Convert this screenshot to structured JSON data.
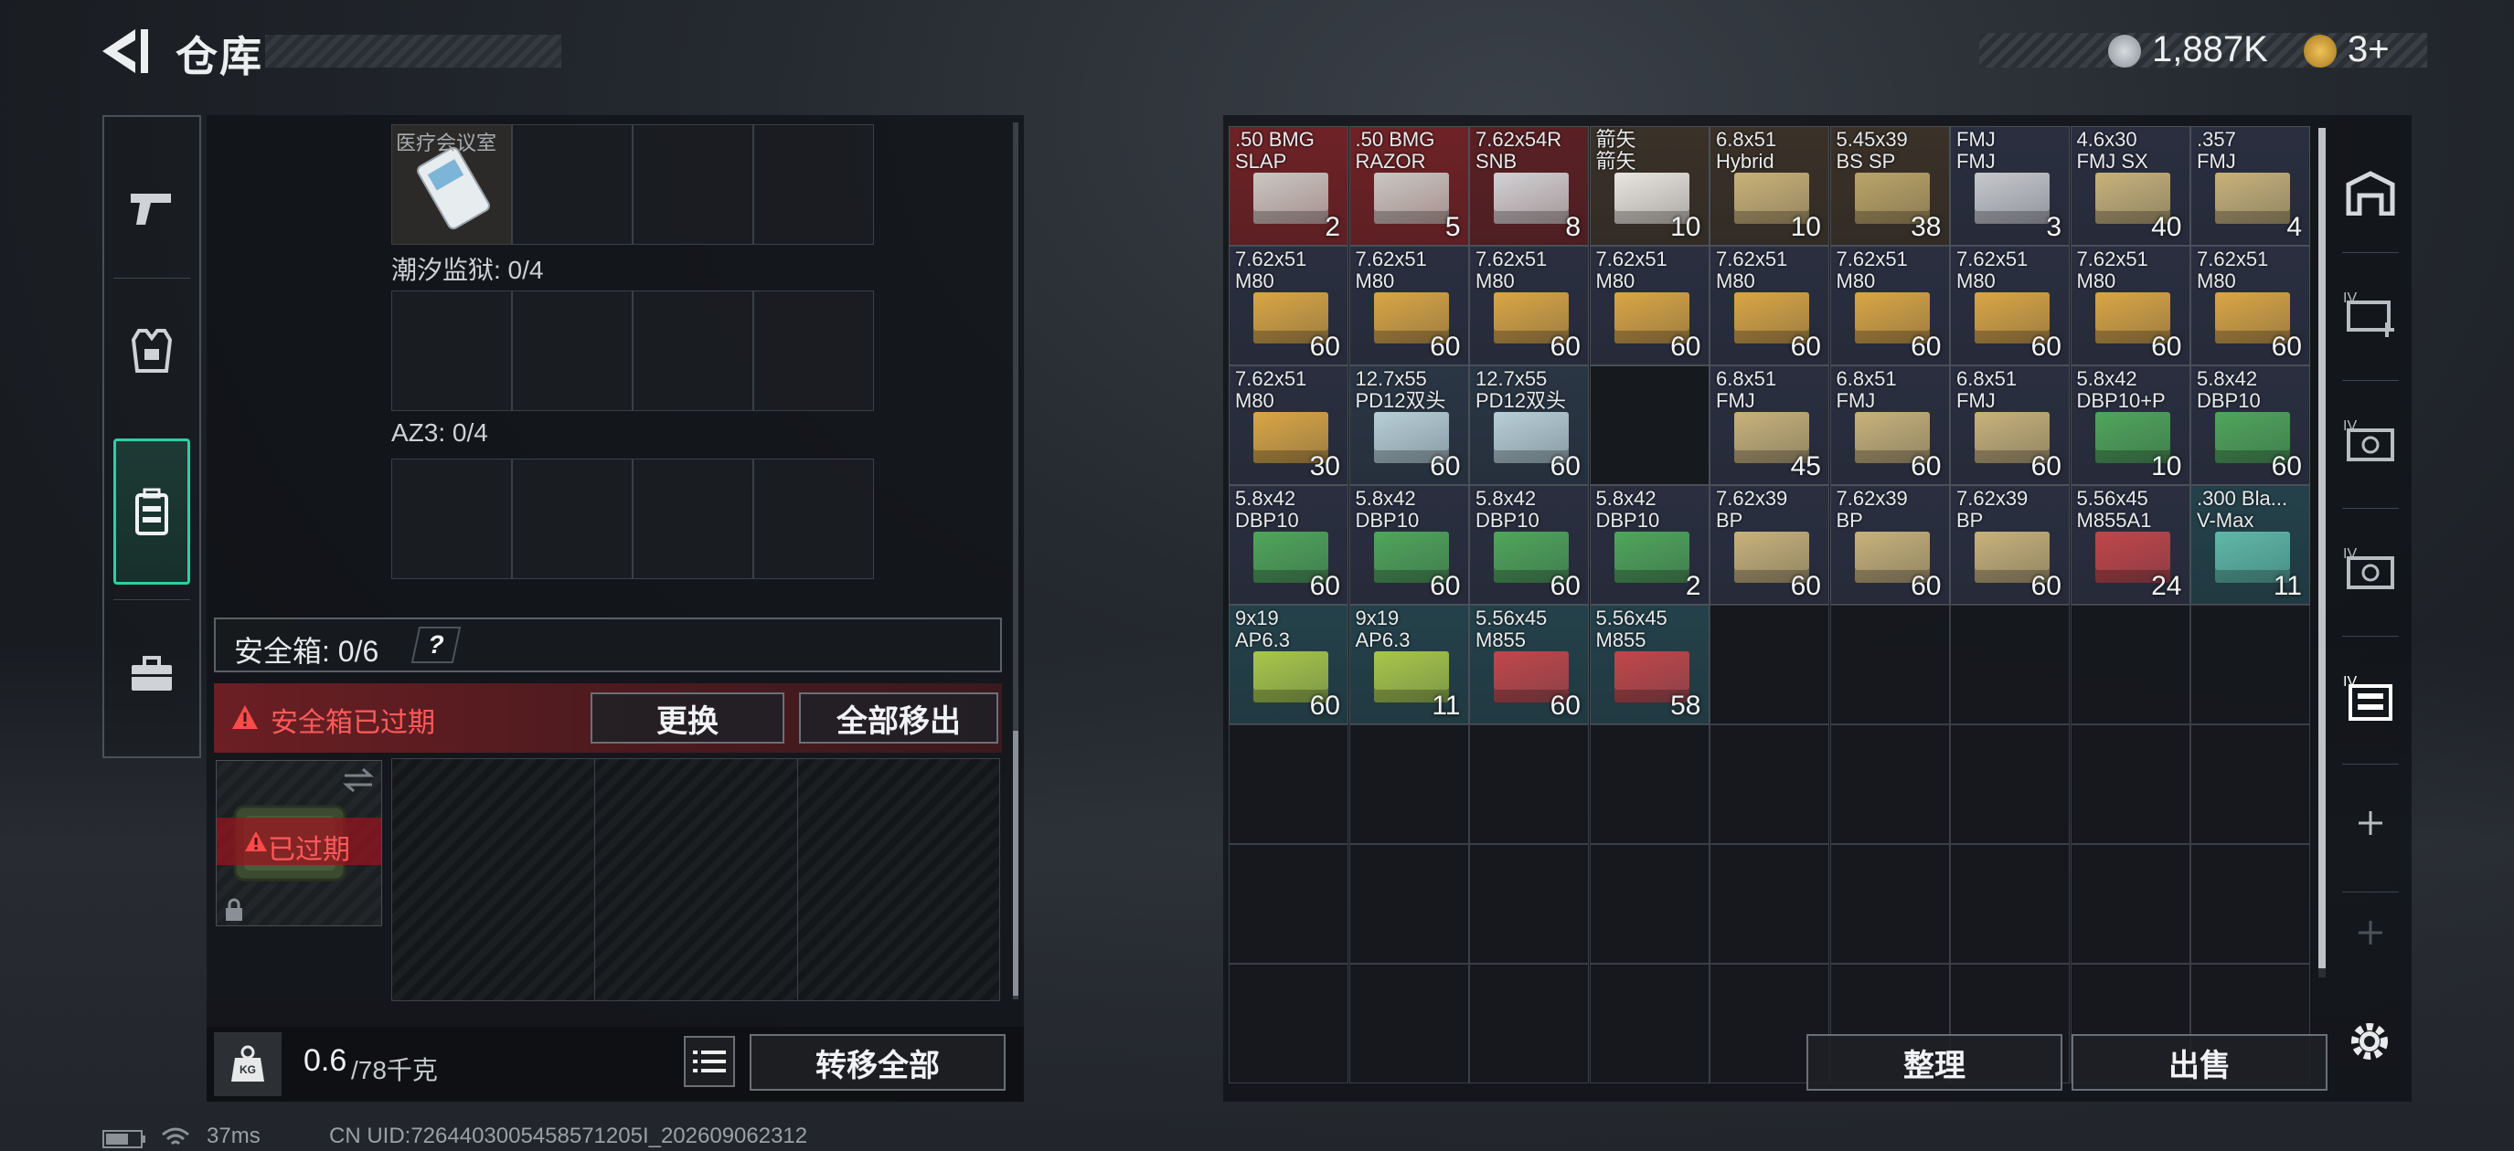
{
  "header": {
    "title": "仓库",
    "currency1": "1,887K",
    "currency2": "3+"
  },
  "left": {
    "slot_label_top": "医疗会议室",
    "section1": "潮汐监狱: 0/4",
    "section2": "AZ3: 0/4",
    "safebox_label": "安全箱: 0/6",
    "help": "?",
    "expired_msg": "安全箱已过期",
    "replace_btn": "更换",
    "move_all_out_btn": "全部移出",
    "expired_badge": "已过期",
    "weight_value": "0.6",
    "weight_total": "/78千克",
    "weight_icon_text": "KG",
    "transfer_all_btn": "转移全部"
  },
  "right": {
    "sort_btn": "整理",
    "sell_btn": "出售",
    "items": [
      {
        "name": ".50 BMG\nSLAP",
        "count": "2",
        "bg": "#6e2226",
        "box": "#c9c7c2"
      },
      {
        "name": ".50 BMG\nRAZOR",
        "count": "5",
        "bg": "#6e2226",
        "box": "#c9c7c2"
      },
      {
        "name": "7.62x54R\nSNB",
        "count": "8",
        "bg": "#5a2024",
        "box": "#d0d2d4"
      },
      {
        "name": "箭矢\n箭矢",
        "count": "10",
        "bg": "#3a3128",
        "box": "#e8e6e2"
      },
      {
        "name": "6.8x51\nHybrid",
        "count": "10",
        "bg": "#3a3128",
        "box": "#c8b27a"
      },
      {
        "name": "5.45x39\nBS SP",
        "count": "38",
        "bg": "#3a3128",
        "box": "#b9a46a"
      },
      {
        "name": "FMJ\nFMJ",
        "count": "3",
        "bg": "#2a2f40",
        "box": "#c6c8cc"
      },
      {
        "name": "4.6x30\nFMJ SX",
        "count": "40",
        "bg": "#2a2f40",
        "box": "#c8b27a"
      },
      {
        "name": ".357\nFMJ",
        "count": "4",
        "bg": "#2a2f40",
        "box": "#c8b27a"
      },
      {
        "name": "7.62x51\nM80",
        "count": "60",
        "bg": "#2a2f40",
        "box": "#d9a645"
      },
      {
        "name": "7.62x51\nM80",
        "count": "60",
        "bg": "#2a2f40",
        "box": "#d9a645"
      },
      {
        "name": "7.62x51\nM80",
        "count": "60",
        "bg": "#2a2f40",
        "box": "#d9a645"
      },
      {
        "name": "7.62x51\nM80",
        "count": "60",
        "bg": "#2a2f40",
        "box": "#d9a645"
      },
      {
        "name": "7.62x51\nM80",
        "count": "60",
        "bg": "#2a2f40",
        "box": "#d9a645"
      },
      {
        "name": "7.62x51\nM80",
        "count": "60",
        "bg": "#2a2f40",
        "box": "#d9a645"
      },
      {
        "name": "7.62x51\nM80",
        "count": "60",
        "bg": "#2a2f40",
        "box": "#d9a645"
      },
      {
        "name": "7.62x51\nM80",
        "count": "60",
        "bg": "#2a2f40",
        "box": "#d9a645"
      },
      {
        "name": "7.62x51\nM80",
        "count": "60",
        "bg": "#2a2f40",
        "box": "#d9a645"
      },
      {
        "name": "7.62x51\nM80",
        "count": "30",
        "bg": "#2a2f40",
        "box": "#d9a645"
      },
      {
        "name": "12.7x55\nPD12双头",
        "count": "60",
        "bg": "#2a3644",
        "box": "#b8cfd6"
      },
      {
        "name": "12.7x55\nPD12双头",
        "count": "60",
        "bg": "#2a3644",
        "box": "#b8cfd6"
      },
      {
        "name": "",
        "count": "",
        "bg": "#16191d",
        "box": ""
      },
      {
        "name": "6.8x51\nFMJ",
        "count": "45",
        "bg": "#2a2f40",
        "box": "#c8b27a"
      },
      {
        "name": "6.8x51\nFMJ",
        "count": "60",
        "bg": "#2a2f40",
        "box": "#c8b27a"
      },
      {
        "name": "6.8x51\nFMJ",
        "count": "60",
        "bg": "#2a2f40",
        "box": "#c8b27a"
      },
      {
        "name": "5.8x42\nDBP10+P",
        "count": "10",
        "bg": "#2a2f40",
        "box": "#4fa65a"
      },
      {
        "name": "5.8x42\nDBP10",
        "count": "60",
        "bg": "#2a2f40",
        "box": "#4fa65a"
      },
      {
        "name": "5.8x42\nDBP10",
        "count": "60",
        "bg": "#2a2f40",
        "box": "#4fa65a"
      },
      {
        "name": "5.8x42\nDBP10",
        "count": "60",
        "bg": "#2a2f40",
        "box": "#4fa65a"
      },
      {
        "name": "5.8x42\nDBP10",
        "count": "60",
        "bg": "#2a2f40",
        "box": "#4fa65a"
      },
      {
        "name": "5.8x42\nDBP10",
        "count": "2",
        "bg": "#2a2f40",
        "box": "#4fa65a"
      },
      {
        "name": "7.62x39\nBP",
        "count": "60",
        "bg": "#2a2f40",
        "box": "#c8b27a"
      },
      {
        "name": "7.62x39\nBP",
        "count": "60",
        "bg": "#2a2f40",
        "box": "#c8b27a"
      },
      {
        "name": "7.62x39\nBP",
        "count": "60",
        "bg": "#2a2f40",
        "box": "#c8b27a"
      },
      {
        "name": "5.56x45\nM855A1",
        "count": "24",
        "bg": "#2a2f40",
        "box": "#c0464a"
      },
      {
        "name": ".300 Bla...\nV-Max",
        "count": "11",
        "bg": "#24414a",
        "box": "#5fb8a8"
      },
      {
        "name": "9x19\nAP6.3",
        "count": "60",
        "bg": "#24414a",
        "box": "#a9c64a"
      },
      {
        "name": "9x19\nAP6.3",
        "count": "11",
        "bg": "#24414a",
        "box": "#a9c64a"
      },
      {
        "name": "5.56x45\nM855",
        "count": "60",
        "bg": "#24414a",
        "box": "#c0464a"
      },
      {
        "name": "5.56x45\nM855",
        "count": "58",
        "bg": "#24414a",
        "box": "#c0464a"
      }
    ]
  },
  "status": {
    "ping": "37ms",
    "uid": "CN UID:7264403005458571205I_202609062312"
  },
  "colors": {
    "accent": "#2bd1a4",
    "danger": "#ff5a5a"
  }
}
